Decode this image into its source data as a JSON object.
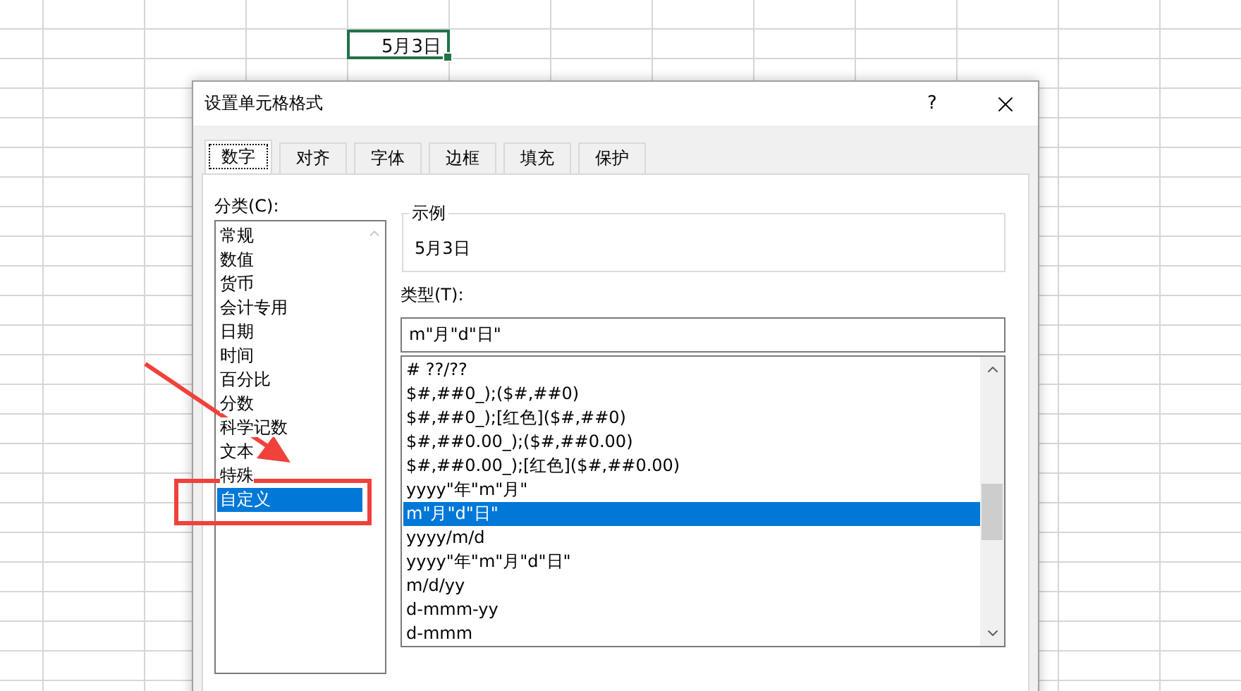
{
  "sheet": {
    "active_cell": "5月3日"
  },
  "dialog": {
    "title": "设置单元格格式",
    "help": "?"
  },
  "tabs": [
    {
      "label": "数字",
      "selected": true
    },
    {
      "label": "对齐",
      "selected": false
    },
    {
      "label": "字体",
      "selected": false
    },
    {
      "label": "边框",
      "selected": false
    },
    {
      "label": "填充",
      "selected": false
    },
    {
      "label": "保护",
      "selected": false
    }
  ],
  "category_label": "分类(C):",
  "categories": [
    {
      "label": "常规",
      "selected": false
    },
    {
      "label": "数值",
      "selected": false
    },
    {
      "label": "货币",
      "selected": false
    },
    {
      "label": "会计专用",
      "selected": false
    },
    {
      "label": "日期",
      "selected": false
    },
    {
      "label": "时间",
      "selected": false
    },
    {
      "label": "百分比",
      "selected": false
    },
    {
      "label": "分数",
      "selected": false
    },
    {
      "label": "科学记数",
      "selected": false
    },
    {
      "label": "文本",
      "selected": false
    },
    {
      "label": "特殊",
      "selected": false
    },
    {
      "label": "自定义",
      "selected": true
    }
  ],
  "sample": {
    "label": "示例",
    "value": "5月3日"
  },
  "type_label": "类型(T):",
  "type_input": {
    "value": "m\"月\"d\"日\""
  },
  "formats": [
    {
      "label": "# ??/??",
      "selected": false
    },
    {
      "label": "$#,##0_);($#,##0)",
      "selected": false
    },
    {
      "label": "$#,##0_);[红色]($#,##0)",
      "selected": false
    },
    {
      "label": "$#,##0.00_);($#,##0.00)",
      "selected": false
    },
    {
      "label": "$#,##0.00_);[红色]($#,##0.00)",
      "selected": false
    },
    {
      "label": "yyyy\"年\"m\"月\"",
      "selected": false
    },
    {
      "label": "m\"月\"d\"日\"",
      "selected": true
    },
    {
      "label": "yyyy/m/d",
      "selected": false
    },
    {
      "label": "yyyy\"年\"m\"月\"d\"日\"",
      "selected": false
    },
    {
      "label": "m/d/yy",
      "selected": false
    },
    {
      "label": "d-mmm-yy",
      "selected": false
    },
    {
      "label": "d-mmm",
      "selected": false
    }
  ]
}
